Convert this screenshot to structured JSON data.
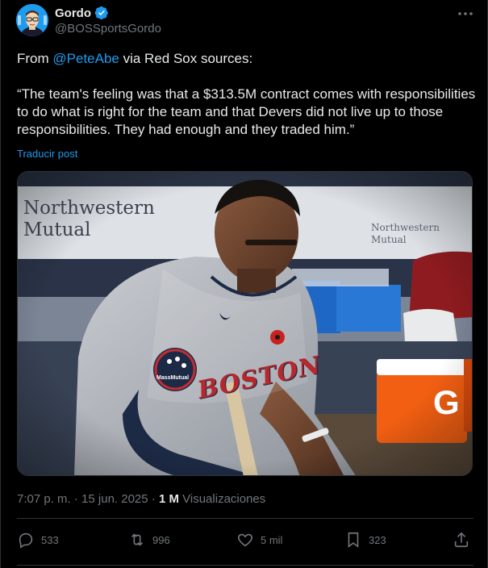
{
  "author": {
    "display_name": "Gordo",
    "handle": "@BOSSportsGordo"
  },
  "post": {
    "text_prefix": "From ",
    "mention": "@PeteAbe",
    "text_suffix": " via Red Sox sources:",
    "quote": "“The team's feeling was that a $313.5M contract comes with responsibilities to do what is right for the team and that Devers did not live up to those responsibilities. They had enough and they traded him.”",
    "translate_label": "Traducir post"
  },
  "media": {
    "banner_line1": "Northwestern",
    "banner_line2": "Mutual",
    "banner2_line1": "Northwestern",
    "banner2_line2": "Mutual",
    "jersey_text": "BOSTON",
    "patch_text": "MassMutual",
    "cooler_letter": "G"
  },
  "meta": {
    "time": "7:07 p. m.",
    "separator": " · ",
    "date": "15 jun. 2025",
    "views_count": "1 M",
    "views_label": " Visualizaciones"
  },
  "actions": {
    "replies": "533",
    "reposts": "996",
    "likes": "5 mil",
    "bookmarks": "323"
  },
  "colors": {
    "accent": "#1d9bf0",
    "background": "#000000",
    "muted": "#71767b",
    "text": "#e7e9ea"
  },
  "icons": [
    "more-icon",
    "verified-badge-icon",
    "reply-icon",
    "repost-icon",
    "like-icon",
    "bookmark-icon",
    "share-icon"
  ]
}
